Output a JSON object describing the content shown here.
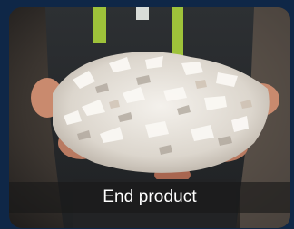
{
  "card": {
    "caption": "End product"
  }
}
